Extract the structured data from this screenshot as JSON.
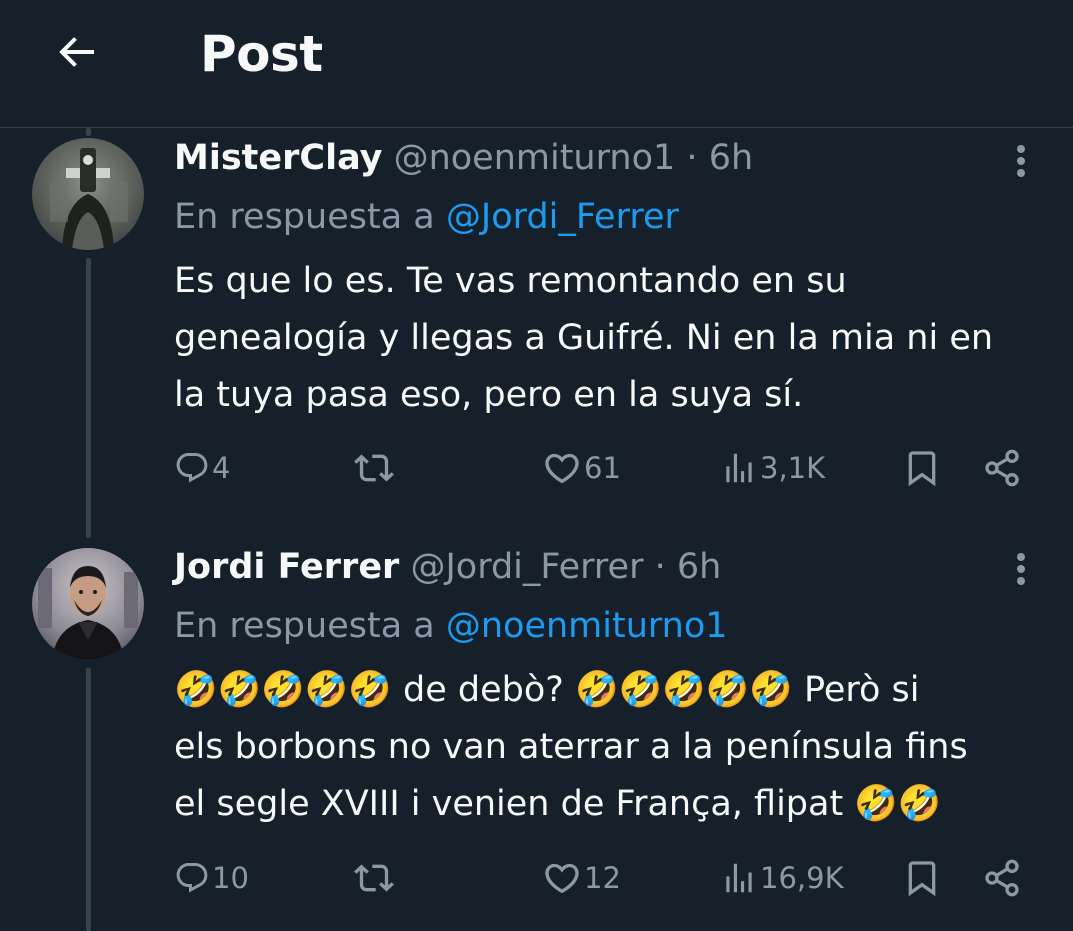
{
  "header": {
    "title": "Post"
  },
  "posts": [
    {
      "display_name": "MisterClay",
      "handle": "@noenmiturno1",
      "separator": "·",
      "time": "6h",
      "reply_prefix": "En respuesta a",
      "reply_to": "@Jordi_Ferrer",
      "lines": [
        "Es que lo es. Te vas remontando en su",
        "genealogía y llegas a Guifré. Ni en la mia ni en",
        "la tuya pasa eso, pero en la suya sí."
      ],
      "replies": "4",
      "reposts": "",
      "likes": "61",
      "views": "3,1K"
    },
    {
      "display_name": "Jordi Ferrer",
      "handle": "@Jordi_Ferrer",
      "separator": "·",
      "time": "6h",
      "reply_prefix": "En respuesta a",
      "reply_to": "@noenmiturno1",
      "lines": [
        "🤣🤣🤣🤣🤣 de debò? 🤣🤣🤣🤣🤣 Però si",
        "els borbons no van aterrar a la península fins",
        "el segle XVIII i venien de França, flipat 🤣🤣"
      ],
      "replies": "10",
      "reposts": "",
      "likes": "12",
      "views": "16,9K"
    }
  ],
  "icons": {
    "back": "arrow-left-icon",
    "more": "more-vertical-icon",
    "reply": "reply-icon",
    "repost": "repost-icon",
    "like": "heart-icon",
    "views": "views-icon",
    "bookmark": "bookmark-icon",
    "share": "share-icon"
  },
  "colors": {
    "background": "#15202b",
    "text": "#f7f9f9",
    "muted": "#8b98a5",
    "link": "#1d9bf0",
    "divider": "#38444d"
  }
}
